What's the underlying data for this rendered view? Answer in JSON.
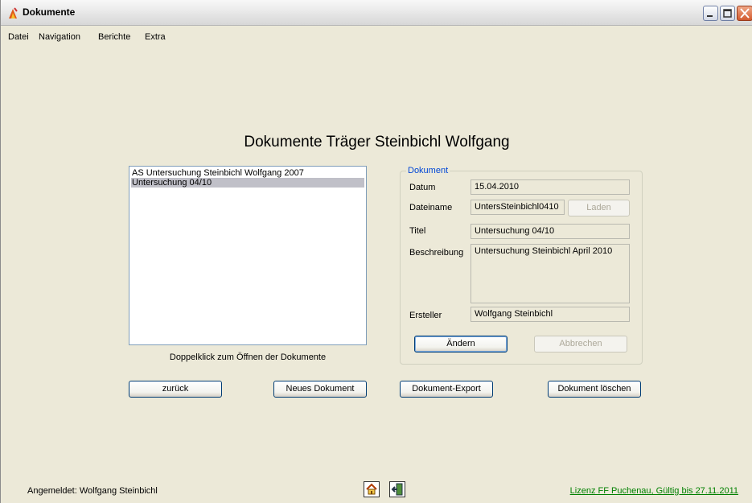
{
  "window": {
    "title": "Dokumente"
  },
  "menu": [
    "Datei",
    "Navigation",
    "Berichte",
    "Extra"
  ],
  "heading": "Dokumente Träger Steinbichl Wolfgang",
  "list": {
    "items": [
      "AS Untersuchung Steinbichl Wolfgang 2007",
      "Untersuchung 04/10"
    ],
    "selected_index": 1,
    "hint": "Doppelklick zum Öffnen der Dokumente"
  },
  "group": {
    "legend": "Dokument",
    "datum_label": "Datum",
    "datum_value": "15.04.2010",
    "dateiname_label": "Dateiname",
    "dateiname_value": "UntersSteinbichl0410",
    "laden": "Laden",
    "titel_label": "Titel",
    "titel_value": "Untersuchung 04/10",
    "beschreibung_label": "Beschreibung",
    "beschreibung_value": "Untersuchung Steinbichl April 2010",
    "ersteller_label": "Ersteller",
    "ersteller_value": "Wolfgang Steinbichl",
    "aendern": "Ändern",
    "abbrechen": "Abbrechen"
  },
  "buttons": {
    "zurueck": "zurück",
    "neu": "Neues Dokument",
    "export": "Dokument-Export",
    "loeschen": "Dokument löschen"
  },
  "status": {
    "user": "Angemeldet: Wolfgang Steinbichl",
    "license": "Lizenz FF Puchenau, Gültig bis 27.11.2011",
    "icons": [
      "home-icon",
      "exit-door-icon"
    ]
  },
  "colors": {
    "legend": "#0046d5",
    "license": "#008000",
    "selection": "#c0c0c8"
  }
}
